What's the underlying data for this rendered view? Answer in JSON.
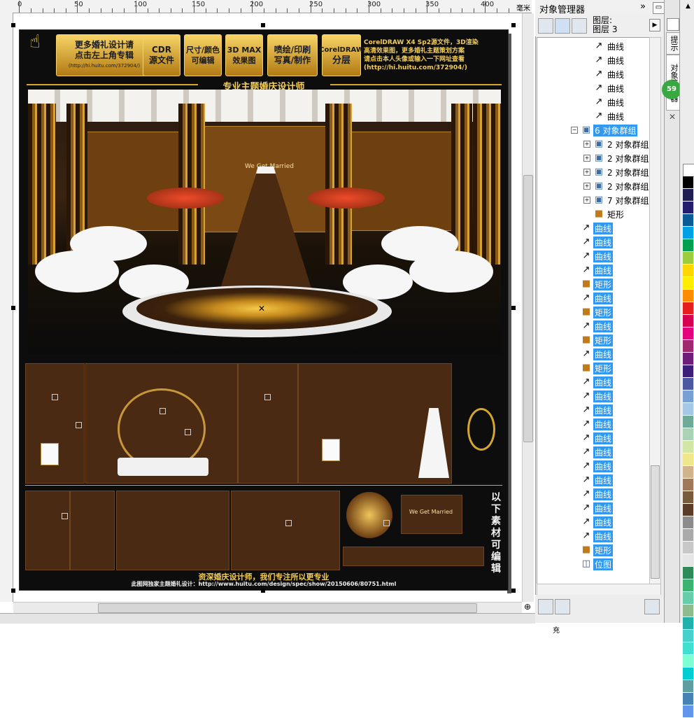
{
  "ruler": {
    "labels": [
      "0",
      "50",
      "100",
      "150",
      "200",
      "250",
      "300",
      "350",
      "400"
    ],
    "unit": "毫米"
  },
  "poster": {
    "banner": {
      "promo_line1": "更多婚礼设计请",
      "promo_line2": "点击左上角专辑",
      "btn1_line1": "CDR",
      "btn1_line2": "源文件",
      "btn2_line1": "尺寸/颜色",
      "btn2_line2": "可编辑",
      "btn3_line1": "3D MAX",
      "btn3_line2": "效果图",
      "btn4_line1": "喷绘/印刷",
      "btn4_line2": "写真/制作",
      "btn5_line1": "CorelDRAW",
      "btn5_line2": "分层",
      "url_small": "(http://hi.huitu.com/372904/)",
      "info_line1": "CorelDRAW X4 Sp2源文件，3D渲染",
      "info_line2": "高清效果图，更多婚礼主题策划方案",
      "info_line3": "请点击本人头像或输入一下网址查看",
      "info_line4": "(http://hi.huitu.com/372904/)"
    },
    "section_title": "专业主题婚庆设计师",
    "side_note": "以下素材可编辑",
    "footer_line1": "资深婚庆设计师，我们专注所以更专业",
    "footer_line2": "此图网独家主题婚礼设计：http://www.huitu.com/design/spec/show/20150606/80751.html",
    "sign_text": "We Get Married"
  },
  "object_manager": {
    "title": "对象管理器",
    "layer_label": "图层:",
    "layer_name": "图层 3",
    "tree": [
      {
        "label": "曲线",
        "icon": "curve-icon",
        "indent": 1,
        "selected": false
      },
      {
        "label": "曲线",
        "icon": "curve-icon",
        "indent": 1,
        "selected": false
      },
      {
        "label": "曲线",
        "icon": "curve-icon",
        "indent": 1,
        "selected": false
      },
      {
        "label": "曲线",
        "icon": "curve-icon",
        "indent": 1,
        "selected": false
      },
      {
        "label": "曲线",
        "icon": "curve-icon",
        "indent": 1,
        "selected": false
      },
      {
        "label": "曲线",
        "icon": "curve-icon",
        "indent": 1,
        "selected": false
      },
      {
        "label": "6 对象群组",
        "icon": "group-icon",
        "indent": 0,
        "selected": true,
        "expander": "−"
      },
      {
        "label": "2 对象群组",
        "icon": "group-icon",
        "indent": 1,
        "selected": false,
        "expander": "+"
      },
      {
        "label": "2 对象群组",
        "icon": "group-icon",
        "indent": 1,
        "selected": false,
        "expander": "+"
      },
      {
        "label": "2 对象群组",
        "icon": "group-icon",
        "indent": 1,
        "selected": false,
        "expander": "+"
      },
      {
        "label": "2 对象群组",
        "icon": "group-icon",
        "indent": 1,
        "selected": false,
        "expander": "+"
      },
      {
        "label": "7 对象群组",
        "icon": "group-icon",
        "indent": 1,
        "selected": false,
        "expander": "+"
      },
      {
        "label": "矩形",
        "icon": "rectangle-icon",
        "indent": 1,
        "selected": false
      },
      {
        "label": "曲线",
        "icon": "curve-icon",
        "indent": 0,
        "selected": true
      },
      {
        "label": "曲线",
        "icon": "curve-icon",
        "indent": 0,
        "selected": true
      },
      {
        "label": "曲线",
        "icon": "curve-icon",
        "indent": 0,
        "selected": true
      },
      {
        "label": "曲线",
        "icon": "curve-icon",
        "indent": 0,
        "selected": true
      },
      {
        "label": "矩形",
        "icon": "rectangle-icon",
        "indent": 0,
        "selected": true
      },
      {
        "label": "曲线",
        "icon": "curve-icon",
        "indent": 0,
        "selected": true
      },
      {
        "label": "矩形",
        "icon": "rectangle-icon",
        "indent": 0,
        "selected": true
      },
      {
        "label": "曲线",
        "icon": "curve-icon",
        "indent": 0,
        "selected": true
      },
      {
        "label": "矩形",
        "icon": "rectangle-icon",
        "indent": 0,
        "selected": true
      },
      {
        "label": "曲线",
        "icon": "curve-icon",
        "indent": 0,
        "selected": true
      },
      {
        "label": "矩形",
        "icon": "rectangle-icon",
        "indent": 0,
        "selected": true
      },
      {
        "label": "曲线",
        "icon": "curve-icon",
        "indent": 0,
        "selected": true
      },
      {
        "label": "曲线",
        "icon": "curve-icon",
        "indent": 0,
        "selected": true
      },
      {
        "label": "曲线",
        "icon": "curve-icon",
        "indent": 0,
        "selected": true
      },
      {
        "label": "曲线",
        "icon": "curve-icon",
        "indent": 0,
        "selected": true
      },
      {
        "label": "曲线",
        "icon": "curve-icon",
        "indent": 0,
        "selected": true
      },
      {
        "label": "曲线",
        "icon": "curve-icon",
        "indent": 0,
        "selected": true
      },
      {
        "label": "曲线",
        "icon": "curve-icon",
        "indent": 0,
        "selected": true
      },
      {
        "label": "曲线",
        "icon": "curve-icon",
        "indent": 0,
        "selected": true
      },
      {
        "label": "曲线",
        "icon": "curve-icon",
        "indent": 0,
        "selected": true
      },
      {
        "label": "曲线",
        "icon": "curve-icon",
        "indent": 0,
        "selected": true
      },
      {
        "label": "曲线",
        "icon": "curve-icon",
        "indent": 0,
        "selected": true
      },
      {
        "label": "曲线",
        "icon": "curve-icon",
        "indent": 0,
        "selected": true
      },
      {
        "label": "矩形",
        "icon": "rectangle-icon",
        "indent": 0,
        "selected": true
      },
      {
        "label": "位图",
        "icon": "bitmap-icon",
        "indent": 0,
        "selected": true
      }
    ]
  },
  "side_tabs": {
    "tab1": "提示",
    "tab2": "对象管理器"
  },
  "badge": "59",
  "status_text": "填充",
  "palette_colors": [
    "#ffffff",
    "#000000",
    "#1e1e50",
    "#241e6e",
    "#0a5a96",
    "#00a0e6",
    "#00a050",
    "#9bcd3c",
    "#ffd700",
    "#ffed00",
    "#ff8c00",
    "#e61e1e",
    "#d70050",
    "#e6007e",
    "#a0286e",
    "#6e1e78",
    "#3c1e78",
    "#4b5aa0",
    "#78a0d2",
    "#a5c8e6",
    "#6eaa96",
    "#aad2b4",
    "#d2e6a5",
    "#f0e68c",
    "#d2b48c",
    "#a0785a",
    "#785a3c",
    "#5a3c28",
    "#8c8c8c",
    "#aaaaaa",
    "#c8c8c8",
    "#e6e6e6",
    "#2e8b57",
    "#3cb371",
    "#66cdaa",
    "#8fbc8f",
    "#20b2aa",
    "#48d1cc",
    "#40e0d0",
    "#7fffd4",
    "#00ced1",
    "#5f9ea0",
    "#4682b4",
    "#6495ed"
  ]
}
